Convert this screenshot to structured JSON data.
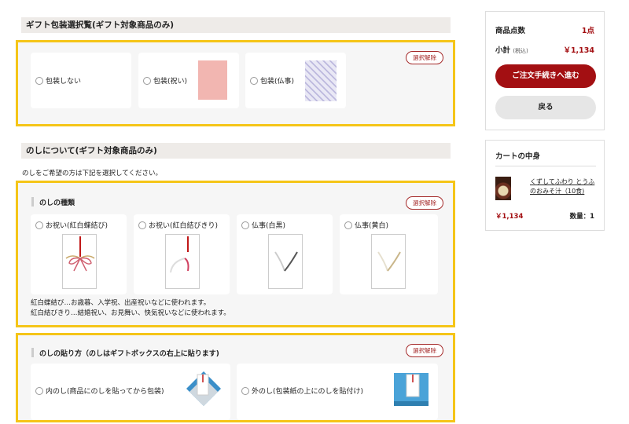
{
  "gift_wrap": {
    "title": "ギフト包装選択覧(ギフト対象商品のみ)",
    "clear_label": "選択解除",
    "options": [
      {
        "label": "包装しない"
      },
      {
        "label": "包装(祝い)"
      },
      {
        "label": "包装(仏事)"
      }
    ]
  },
  "noshi": {
    "title": "のしについて(ギフト対象商品のみ)",
    "intro": "のしをご希望の方は下記を選択してください。",
    "types": {
      "heading": "のしの種類",
      "clear_label": "選択解除",
      "options": [
        {
          "label": "お祝い(紅白蝶結び)"
        },
        {
          "label": "お祝い(紅白結びきり)"
        },
        {
          "label": "仏事(白黒)"
        },
        {
          "label": "仏事(黄白)"
        }
      ],
      "note_line1": "紅白蝶結び…お歳暮、入学祝、出産祝いなどに使われます。",
      "note_line2": "紅白結びきり…結婚祝い、お見舞い、快気祝いなどに使われます。"
    },
    "placement": {
      "heading": "のしの貼り方（のしはギフトボックスの右上に貼ります)",
      "clear_label": "選択解除",
      "options": [
        {
          "label": "内のし(商品にのしを貼ってから包装)"
        },
        {
          "label": "外のし(包装紙の上にのしを貼付け)"
        }
      ]
    }
  },
  "summary": {
    "count_label": "商品点数",
    "count_value": "1点",
    "subtotal_label": "小計",
    "tax_label": "(税込)",
    "subtotal_value": "￥1,134",
    "checkout_label": "ご注文手続きへ進む",
    "back_label": "戻る"
  },
  "cart": {
    "title": "カートの中身",
    "item_name": "くずしてふわり とうふのおみそ汁（10食)",
    "item_price": "￥1,134",
    "item_qty": "数量：1"
  },
  "colors": {
    "accent": "#a30f12",
    "highlight": "#f5c518"
  }
}
